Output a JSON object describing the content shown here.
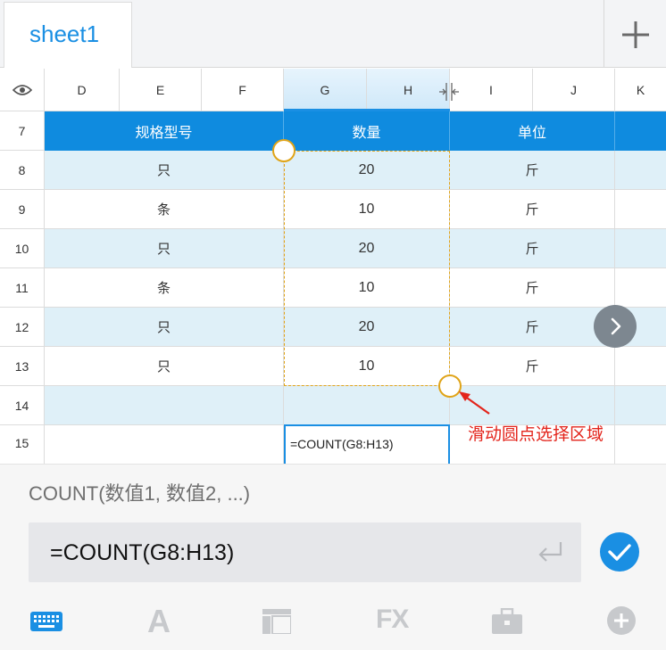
{
  "tabs": {
    "active_sheet": "sheet1",
    "add_label": "+"
  },
  "grid": {
    "visibility_icon": "eye-icon",
    "columns": [
      "D",
      "E",
      "F",
      "G",
      "H",
      "I",
      "J",
      "K"
    ],
    "rows": [
      "7",
      "8",
      "9",
      "10",
      "11",
      "12",
      "13",
      "14",
      "15"
    ],
    "header_row": {
      "spec": "规格型号",
      "qty": "数量",
      "unit": "单位"
    },
    "data_rows": [
      {
        "spec": "只",
        "qty": "20",
        "unit": "斤"
      },
      {
        "spec": "条",
        "qty": "10",
        "unit": "斤"
      },
      {
        "spec": "只",
        "qty": "20",
        "unit": "斤"
      },
      {
        "spec": "条",
        "qty": "10",
        "unit": "斤"
      },
      {
        "spec": "只",
        "qty": "20",
        "unit": "斤"
      },
      {
        "spec": "只",
        "qty": "10",
        "unit": "斤"
      }
    ],
    "active_cell_value": "=COUNT(G8:H13)"
  },
  "annotation": {
    "hint": "滑动圆点选择区域"
  },
  "formula_panel": {
    "function_hint": "COUNT(数值1, 数值2, ...)",
    "formula": "=COUNT(G8:H13)"
  },
  "toolbar": {
    "icons": [
      "keyboard-icon",
      "font-icon",
      "layout-icon",
      "fx-icon",
      "toolbox-icon",
      "add-circle-icon"
    ],
    "font_glyph": "A",
    "fx_glyph": "FX"
  },
  "colors": {
    "accent": "#1a8fe3",
    "header_fill": "#0f8bdf",
    "band_fill": "#dff0f8",
    "selection": "#e0a418",
    "hint_red": "#e3241b"
  }
}
